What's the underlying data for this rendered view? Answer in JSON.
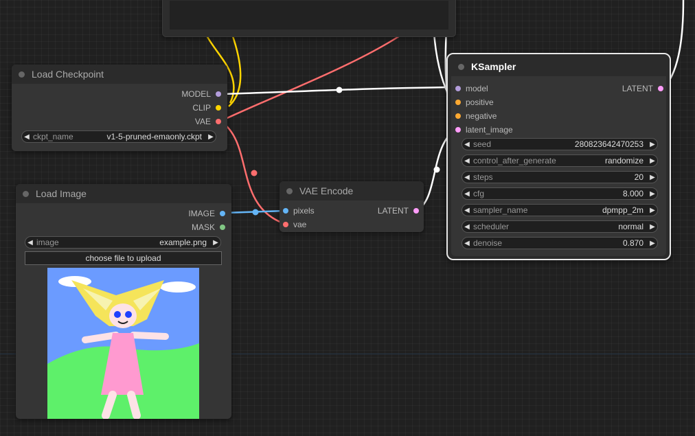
{
  "nodes": {
    "load_checkpoint": {
      "title": "Load Checkpoint",
      "outputs": [
        "MODEL",
        "CLIP",
        "VAE"
      ],
      "widget": {
        "label": "ckpt_name",
        "value": "v1-5-pruned-emaonly.ckpt"
      }
    },
    "load_image": {
      "title": "Load Image",
      "outputs": [
        "IMAGE",
        "MASK"
      ],
      "widget": {
        "label": "image",
        "value": "example.png"
      },
      "upload_label": "choose file to upload"
    },
    "vae_encode": {
      "title": "VAE Encode",
      "inputs": [
        "pixels",
        "vae"
      ],
      "output": "LATENT"
    },
    "ksampler": {
      "title": "KSampler",
      "inputs": [
        "model",
        "positive",
        "negative",
        "latent_image"
      ],
      "output": "LATENT",
      "widgets": [
        {
          "label": "seed",
          "value": "280823642470253"
        },
        {
          "label": "control_after_generate",
          "value": "randomize"
        },
        {
          "label": "steps",
          "value": "20"
        },
        {
          "label": "cfg",
          "value": "8.000"
        },
        {
          "label": "sampler_name",
          "value": "dpmpp_2m"
        },
        {
          "label": "scheduler",
          "value": "normal"
        },
        {
          "label": "denoise",
          "value": "0.870"
        }
      ]
    }
  },
  "arrows": {
    "left": "◀",
    "right": "▶"
  },
  "colors": {
    "model": "#b39ddb",
    "clip": "#ffd500",
    "vae": "#ff6e6e",
    "image": "#64b5f6",
    "mask": "#81c784",
    "latent": "#ff9cf9",
    "conditioning": "#ffa931",
    "wire_white": "#ffffff"
  }
}
